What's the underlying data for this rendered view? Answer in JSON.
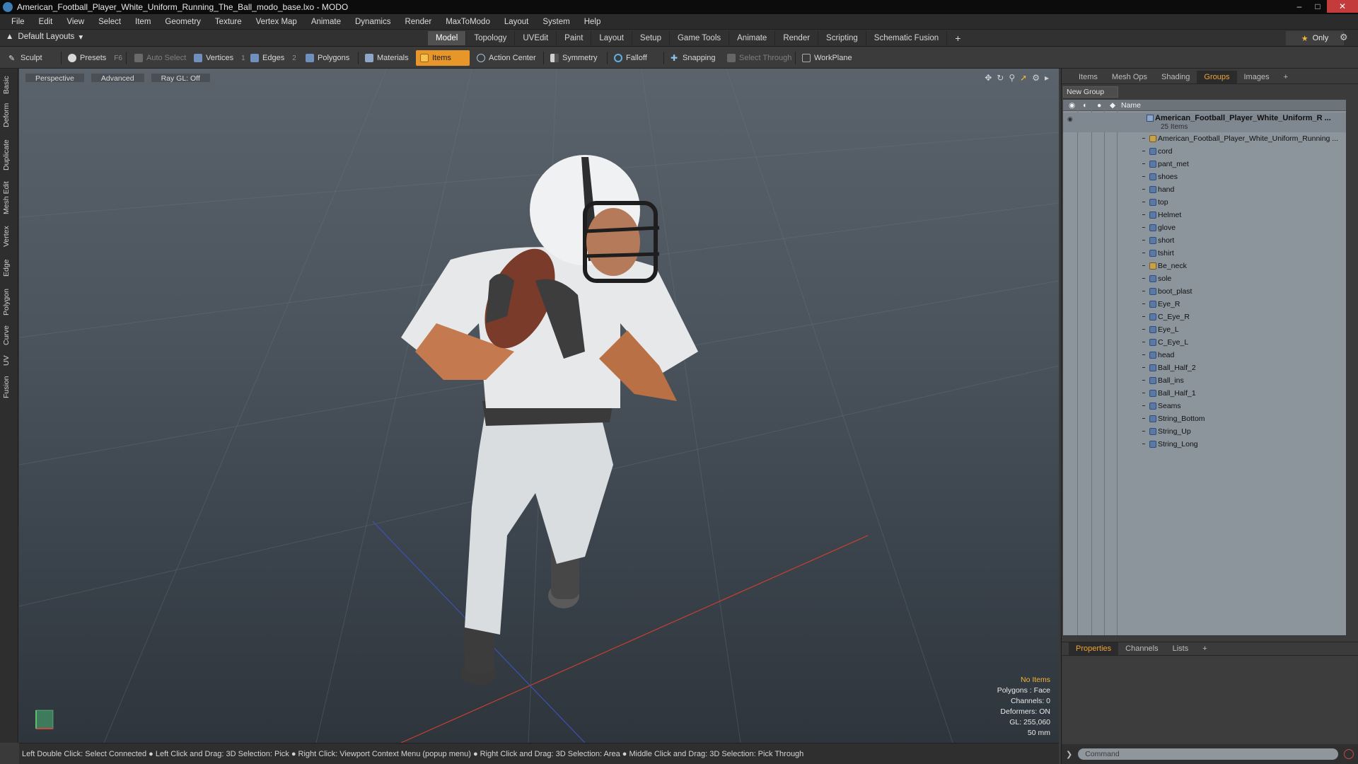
{
  "window": {
    "title": "American_Football_Player_White_Uniform_Running_The_Ball_modo_base.lxo - MODO",
    "controls": {
      "minimize": "–",
      "maximize": "□",
      "close": "✕"
    }
  },
  "menu": [
    "File",
    "Edit",
    "View",
    "Select",
    "Item",
    "Geometry",
    "Texture",
    "Vertex Map",
    "Animate",
    "Dynamics",
    "Render",
    "MaxToModo",
    "Layout",
    "System",
    "Help"
  ],
  "layout_dropdown": "Default Layouts",
  "mode_tabs": [
    "Model",
    "Topology",
    "UVEdit",
    "Paint",
    "Layout",
    "Setup",
    "Game Tools",
    "Animate",
    "Render",
    "Scripting",
    "Schematic Fusion"
  ],
  "mode_tab_active": "Model",
  "only_button": "Only",
  "toolbar": {
    "sculpt": "Sculpt",
    "presets": "Presets",
    "presets_key": "F6",
    "auto_select": "Auto Select",
    "vertices": "Vertices",
    "vertices_key": "1",
    "edges": "Edges",
    "edges_key": "2",
    "polygons": "Polygons",
    "materials": "Materials",
    "items": "Items",
    "action_center": "Action Center",
    "symmetry": "Symmetry",
    "falloff": "Falloff",
    "snapping": "Snapping",
    "select_through": "Select Through",
    "workplane": "WorkPlane"
  },
  "left_tabs": [
    "Basic",
    "Deform",
    "Duplicate",
    "Mesh Edit",
    "Vertex",
    "Edge",
    "Polygon",
    "Curve",
    "UV",
    "Fusion"
  ],
  "viewport": {
    "view": "Perspective",
    "shading": "Advanced",
    "raygl": "Ray GL: Off",
    "stats": {
      "items": "No Items",
      "polygons": "Polygons : Face",
      "channels": "Channels: 0",
      "deformers": "Deformers: ON",
      "gl": "GL: 255,060",
      "lens": "50 mm"
    }
  },
  "status_bar": "Left Double Click: Select Connected ● Left Click and Drag: 3D Selection: Pick ● Right Click: Viewport Context Menu (popup menu) ● Right Click and Drag: 3D Selection: Area ● Middle Click and Drag: 3D Selection: Pick Through",
  "right_panel": {
    "tabs": [
      "Items",
      "Mesh Ops",
      "Shading",
      "Groups",
      "Images"
    ],
    "active_tab": "Groups",
    "new_group": "New Group",
    "name_header": "Name",
    "root": {
      "name": "American_Football_Player_White_Uniform_R ...",
      "count": "25 Items"
    },
    "items": [
      "American_Football_Player_White_Uniform_Running ...",
      "cord",
      "pant_met",
      "shoes",
      "hand",
      "top",
      "Helmet",
      "glove",
      "short",
      "tshirt",
      "Be_neck",
      "sole",
      "boot_plast",
      "Eye_R",
      "C_Eye_R",
      "Eye_L",
      "C_Eye_L",
      "head",
      "Ball_Half_2",
      "Ball_ins",
      "Ball_Half_1",
      "Seams",
      "String_Bottom",
      "String_Up",
      "String_Long"
    ],
    "props_tabs": [
      "Properties",
      "Channels",
      "Lists"
    ],
    "props_active": "Properties",
    "command_placeholder": "Command"
  },
  "colors": {
    "accent": "#e7962a",
    "viewport_top": "#5a636c",
    "viewport_bottom": "#2e353c",
    "tree_bg": "#8c949c"
  }
}
